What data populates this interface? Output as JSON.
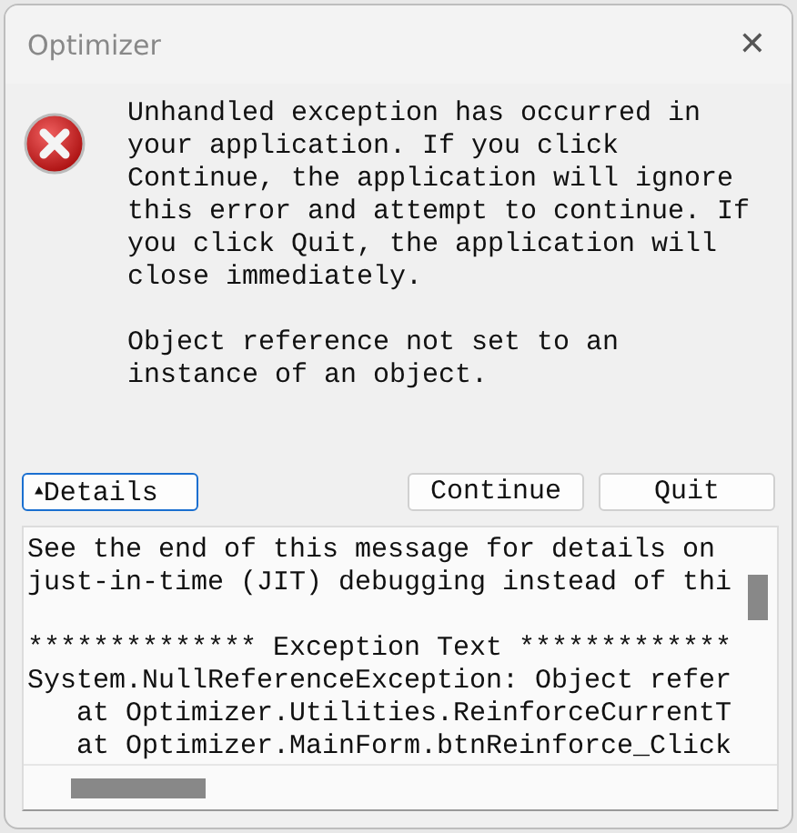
{
  "window": {
    "title": "Optimizer",
    "close": "✕"
  },
  "message": {
    "paragraphs": [
      {
        "lines": [
          "Unhandled exception has occurred in",
          "your application. If you click",
          "Continue, the application will ignore",
          "this error and attempt to continue. If",
          "you click Quit, the application will",
          "close immediately."
        ]
      },
      {
        "lines": [
          "Object reference not set to an",
          "instance of an object."
        ]
      }
    ]
  },
  "buttons": [
    {
      "kind": "toggle",
      "icon": "▲",
      "label": "Details",
      "focused": true
    },
    {
      "kind": "push",
      "label": "Continue",
      "focused": false
    },
    {
      "kind": "push",
      "label": "Quit",
      "focused": false
    }
  ],
  "details": {
    "paragraphs": [
      {
        "lines": [
          "See the end of this message for details on",
          "just-in-time (JIT) debugging instead of thi"
        ]
      },
      {
        "lines": [
          "************** Exception Text *************",
          "System.NullReferenceException: Object refer",
          "   at Optimizer.Utilities.ReinforceCurrentT",
          "   at Optimizer.MainForm.btnReinforce_Click"
        ]
      }
    ]
  }
}
